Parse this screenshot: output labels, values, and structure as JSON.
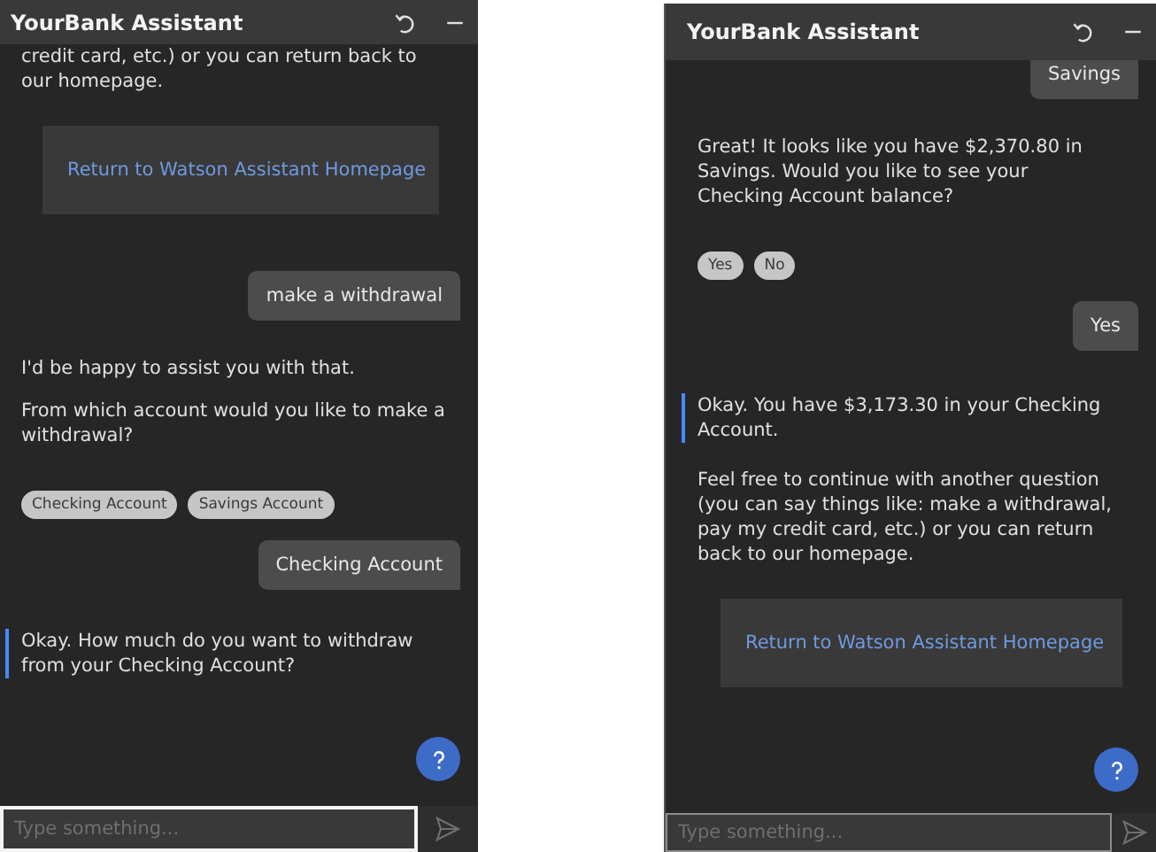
{
  "panels": [
    {
      "title": "YourBank Assistant",
      "input": {
        "placeholder": "Type something...",
        "focused": true
      },
      "messages": [
        {
          "kind": "bot",
          "text": "credit card, etc.) or you can return back to our homepage.",
          "accent": false
        },
        {
          "kind": "link_card",
          "label": "Return to Watson Assistant Homepage"
        },
        {
          "kind": "user",
          "text": "make a withdrawal"
        },
        {
          "kind": "bot",
          "text": "I'd be happy to assist you with that.",
          "accent": false
        },
        {
          "kind": "bot",
          "text": "From which account would you like to make a withdrawal?",
          "accent": false
        },
        {
          "kind": "chips",
          "options": [
            "Checking Account",
            "Savings Account"
          ]
        },
        {
          "kind": "user",
          "text": "Checking Account"
        },
        {
          "kind": "bot",
          "text": "Okay. How much do you want to withdraw from your Checking Account?",
          "accent": true
        }
      ]
    },
    {
      "title": "YourBank Assistant",
      "input": {
        "placeholder": "Type something...",
        "focused": false
      },
      "messages": [
        {
          "kind": "user",
          "text": "Savings"
        },
        {
          "kind": "bot",
          "text": "Great! It looks like you have $2,370.80 in Savings. Would you like to see your Checking Account balance?",
          "accent": false
        },
        {
          "kind": "chips",
          "options": [
            "Yes",
            "No"
          ]
        },
        {
          "kind": "user",
          "text": "Yes"
        },
        {
          "kind": "bot",
          "text": "Okay. You have $3,173.30 in your Checking Account.",
          "accent": true
        },
        {
          "kind": "bot",
          "text": "Feel free to continue with another question (you can say things like: make a withdrawal, pay my credit card, etc.) or you can return back to our homepage.",
          "accent": false
        },
        {
          "kind": "link_card",
          "label": "Return to Watson Assistant Homepage"
        }
      ]
    }
  ]
}
